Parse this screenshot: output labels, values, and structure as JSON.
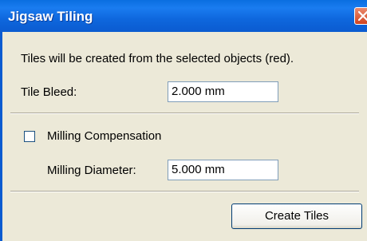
{
  "window": {
    "title": "Jigsaw Tiling",
    "titlebar_color": "#0b5bd0",
    "background": "#ece9d8"
  },
  "dialog": {
    "description": "Tiles will be created from the selected objects (red).",
    "tile_bleed_label": "Tile Bleed:",
    "tile_bleed_value": "2.000 mm",
    "milling_compensation_label": "Milling Compensation",
    "milling_compensation_checked": false,
    "milling_diameter_label": "Milling Diameter:",
    "milling_diameter_value": "5.000 mm",
    "create_tiles_label": "Create Tiles"
  },
  "icons": {
    "close": "close-icon"
  }
}
